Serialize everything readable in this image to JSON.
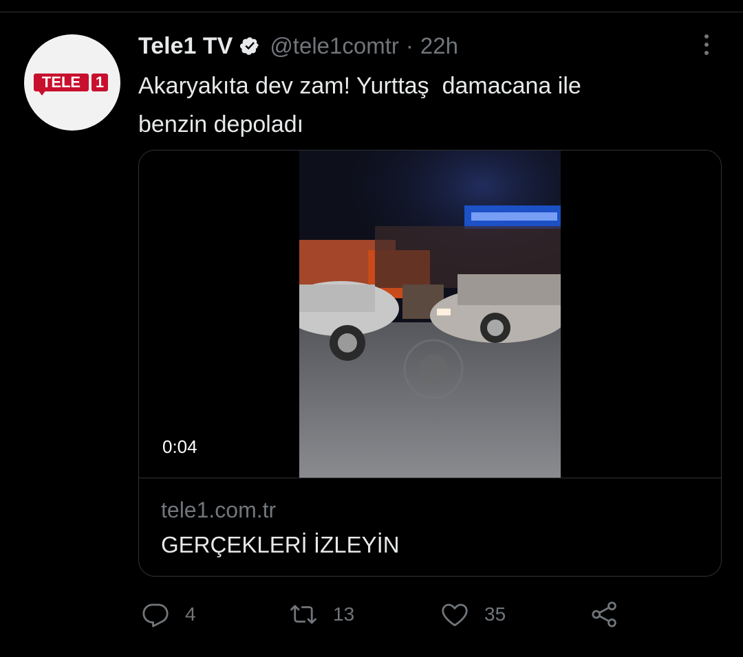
{
  "tweet": {
    "author": {
      "display_name": "Tele1 TV",
      "handle": "@tele1comtr",
      "verified": true,
      "avatar_logo": {
        "word": "TELE",
        "digit": "1",
        "brand_color": "#c8102e",
        "background": "#f2f2f2"
      }
    },
    "separator": "·",
    "time": "22h",
    "text": "Akaryakıta dev zam! Yurttaş  damacana ile\nbenzin depoladı",
    "card": {
      "duration": "0:04",
      "domain": "tele1.com.tr",
      "title": "GERÇEKLERİ İZLEYİN"
    },
    "actions": {
      "replies": "4",
      "retweets": "13",
      "likes": "35"
    }
  },
  "colors": {
    "background": "#000000",
    "text_primary": "#e7e9ea",
    "text_secondary": "#71767b",
    "border": "#2f3336"
  },
  "icons": [
    "verified-badge-icon",
    "more-options-icon",
    "reply-icon",
    "retweet-icon",
    "like-icon",
    "share-icon"
  ]
}
